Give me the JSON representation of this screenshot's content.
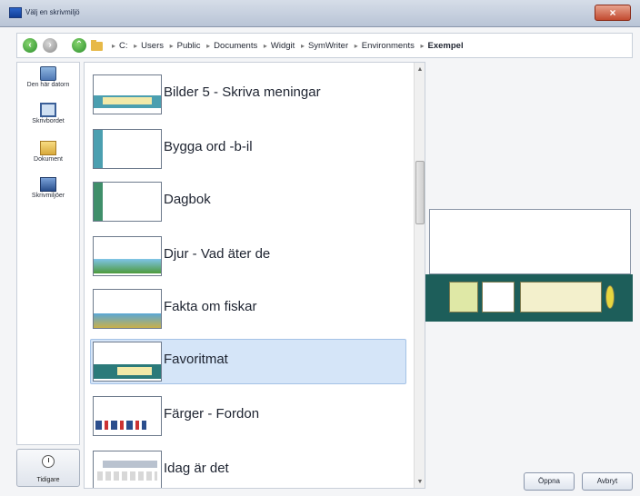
{
  "window": {
    "title": "Välj en skrivmiljö",
    "close_label": "×"
  },
  "nav": {
    "back_icon": "back-arrow-icon",
    "forward_icon": "forward-arrow-icon",
    "up_icon": "up-arrow-icon",
    "breadcrumb": [
      "C:",
      "Users",
      "Public",
      "Documents",
      "Widgit",
      "SymWriter",
      "Environments",
      "Exempel"
    ]
  },
  "places": [
    {
      "label": "Den här datorn",
      "icon": "computer-icon"
    },
    {
      "label": "Skrivbordet",
      "icon": "desktop-icon"
    },
    {
      "label": "Dokument",
      "icon": "documents-folder-icon"
    },
    {
      "label": "Skrivmiljöer",
      "icon": "environments-icon"
    }
  ],
  "recent": {
    "label": "Tidigare"
  },
  "files": [
    {
      "label": "Bilder 5 - Skriva meningar",
      "selected": false
    },
    {
      "label": "Bygga ord -b-il",
      "selected": false
    },
    {
      "label": "Dagbok",
      "selected": false
    },
    {
      "label": "Djur - Vad äter de",
      "selected": false
    },
    {
      "label": "Fakta om fiskar",
      "selected": false
    },
    {
      "label": "Favoritmat",
      "selected": true
    },
    {
      "label": "Färger - Fordon",
      "selected": false
    },
    {
      "label": "Idag är det",
      "selected": false
    }
  ],
  "buttons": {
    "open": "Öppna",
    "cancel": "Avbryt"
  },
  "colors": {
    "selection": "#d5e5f8",
    "preview_band": "#1d5e5a",
    "accent_green": "#2b8f2b"
  }
}
